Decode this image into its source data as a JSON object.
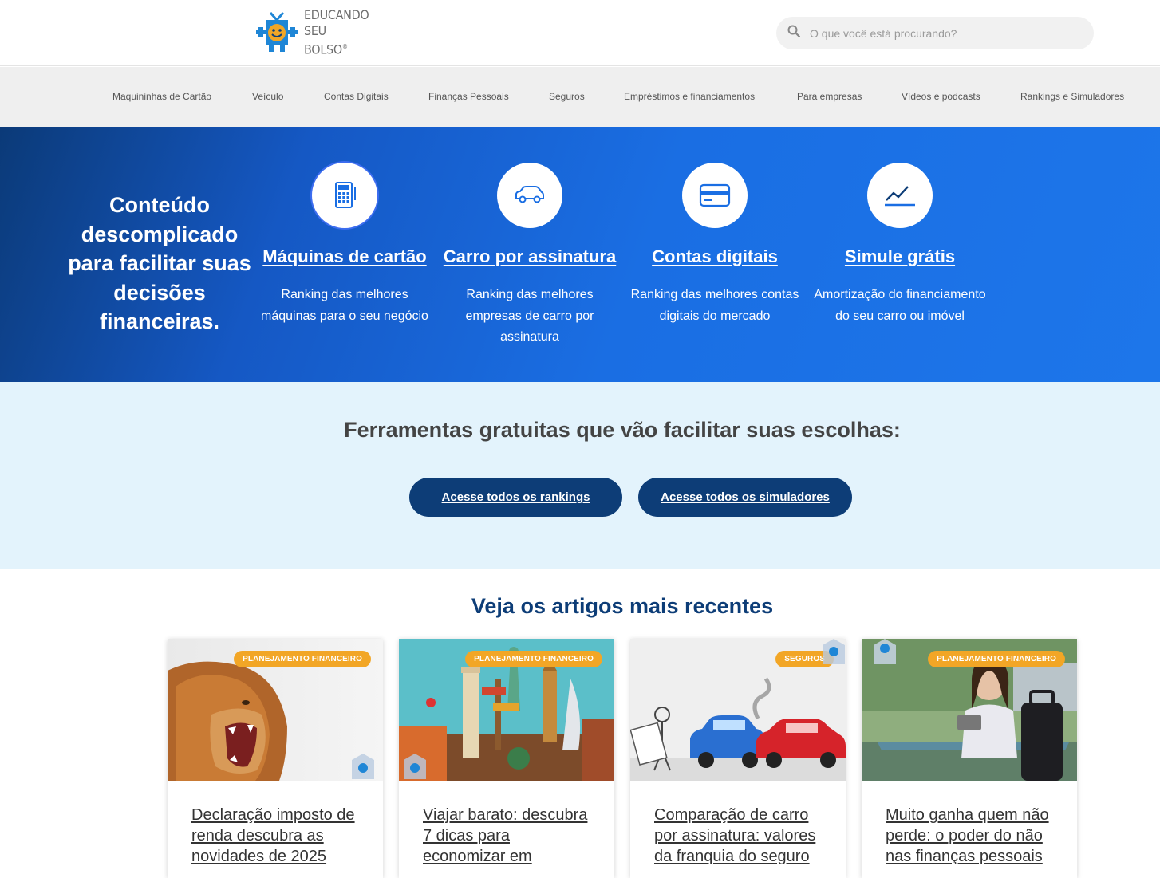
{
  "header": {
    "logo_line1": "EDUCANDO",
    "logo_line2": "SEU BOLSO",
    "logo_mark": "®",
    "search_placeholder": "O que você está procurando?"
  },
  "nav": {
    "items": [
      "Maquininhas de Cartão",
      "Veículo",
      "Contas Digitais",
      "Finanças Pessoais",
      "Seguros",
      "Empréstimos e financiamentos",
      "Para empresas",
      "Vídeos e podcasts",
      "Rankings e Simuladores"
    ]
  },
  "hero": {
    "title": "Conteúdo descomplicado para facilitar suas decisões financeiras.",
    "features": [
      {
        "icon": "calculator-icon",
        "title": "Máquinas de cartão",
        "desc": "Ranking das melhores máquinas para o seu negócio"
      },
      {
        "icon": "car-icon",
        "title": "Carro por assinatura",
        "desc": "Ranking das melhores empresas de carro por assinatura"
      },
      {
        "icon": "credit-card-icon",
        "title": "Contas digitais",
        "desc": "Ranking das melhores contas digitais do mercado"
      },
      {
        "icon": "chart-line-icon",
        "title": "Simule grátis",
        "desc": "Amortização do financiamento do seu carro ou imóvel"
      }
    ]
  },
  "tools": {
    "title": "Ferramentas gratuitas que vão facilitar suas escolhas:",
    "rankings_button": "Acesse todos os rankings",
    "simulators_button": "Acesse todos os simuladores"
  },
  "articles": {
    "title": "Veja os artigos mais recentes",
    "cards": [
      {
        "category": "PLANEJAMENTO FINANCEIRO",
        "title": "Declaração imposto de renda descubra as novidades de 2025"
      },
      {
        "category": "PLANEJAMENTO FINANCEIRO",
        "title": "Viajar barato: descubra 7 dicas para economizar em"
      },
      {
        "category": "SEGUROS",
        "title": "Comparação de carro por assinatura: valores da franquia do seguro"
      },
      {
        "category": "PLANEJAMENTO FINANCEIRO",
        "title": "Muito ganha quem não perde: o poder do não nas finanças pessoais"
      }
    ]
  },
  "colors": {
    "brand_dark": "#0d3d77",
    "hero_blue": "#1a6ee3",
    "badge_orange": "#f2a626",
    "tools_bg": "#e3f3fc"
  }
}
